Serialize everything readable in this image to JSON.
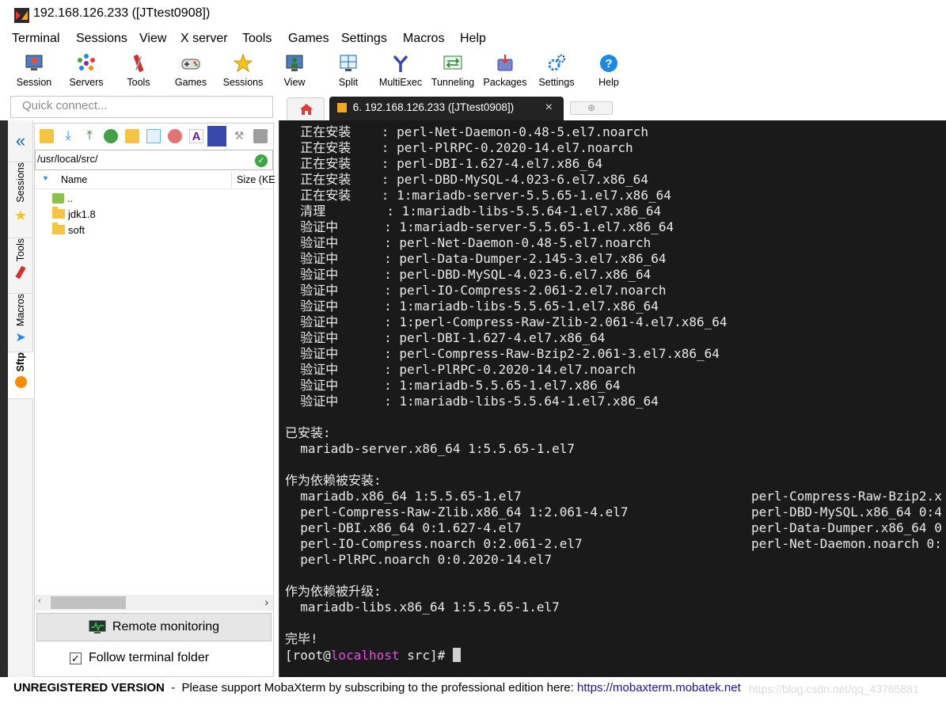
{
  "window": {
    "title": "192.168.126.233 ([JTtest0908])"
  },
  "menu": [
    "Terminal",
    "Sessions",
    "View",
    "X server",
    "Tools",
    "Games",
    "Settings",
    "Macros",
    "Help"
  ],
  "toolbar": [
    {
      "label": "Session",
      "icon": "session-icon"
    },
    {
      "label": "Servers",
      "icon": "servers-icon"
    },
    {
      "label": "Tools",
      "icon": "tools-icon"
    },
    {
      "label": "Games",
      "icon": "games-icon"
    },
    {
      "label": "Sessions",
      "icon": "sessions-star-icon"
    },
    {
      "label": "View",
      "icon": "view-icon"
    },
    {
      "label": "Split",
      "icon": "split-icon"
    },
    {
      "label": "MultiExec",
      "icon": "multiexec-icon"
    },
    {
      "label": "Tunneling",
      "icon": "tunneling-icon"
    },
    {
      "label": "Packages",
      "icon": "packages-icon"
    },
    {
      "label": "Settings",
      "icon": "settings-icon"
    },
    {
      "label": "Help",
      "icon": "help-icon"
    }
  ],
  "quick_connect": {
    "placeholder": "Quick connect..."
  },
  "side_tabs": [
    "Sessions",
    "Tools",
    "Macros",
    "Sftp"
  ],
  "sftp": {
    "path": "/usr/local/src/",
    "columns": {
      "name": "Name",
      "size": "Size (KE"
    },
    "items": [
      {
        "name": ".."
      },
      {
        "name": "jdk1.8"
      },
      {
        "name": "soft"
      }
    ],
    "remote_monitoring": "Remote monitoring",
    "follow_folder": "Follow terminal folder",
    "follow_checked": true
  },
  "tabs": {
    "active": "6. 192.168.126.233 ([JTtest0908])",
    "close": "×"
  },
  "terminal": {
    "lines": [
      "  正在安装    : perl-Net-Daemon-0.48-5.el7.noarch",
      "  正在安装    : perl-PlRPC-0.2020-14.el7.noarch",
      "  正在安装    : perl-DBI-1.627-4.el7.x86_64",
      "  正在安装    : perl-DBD-MySQL-4.023-6.el7.x86_64",
      "  正在安装    : 1:mariadb-server-5.5.65-1.el7.x86_64",
      "  清理        : 1:mariadb-libs-5.5.64-1.el7.x86_64",
      "  验证中      : 1:mariadb-server-5.5.65-1.el7.x86_64",
      "  验证中      : perl-Net-Daemon-0.48-5.el7.noarch",
      "  验证中      : perl-Data-Dumper-2.145-3.el7.x86_64",
      "  验证中      : perl-DBD-MySQL-4.023-6.el7.x86_64",
      "  验证中      : perl-IO-Compress-2.061-2.el7.noarch",
      "  验证中      : 1:mariadb-libs-5.5.65-1.el7.x86_64",
      "  验证中      : 1:perl-Compress-Raw-Zlib-2.061-4.el7.x86_64",
      "  验证中      : perl-DBI-1.627-4.el7.x86_64",
      "  验证中      : perl-Compress-Raw-Bzip2-2.061-3.el7.x86_64",
      "  验证中      : perl-PlRPC-0.2020-14.el7.noarch",
      "  验证中      : 1:mariadb-5.5.65-1.el7.x86_64",
      "  验证中      : 1:mariadb-libs-5.5.64-1.el7.x86_64",
      "",
      "已安装:",
      "  mariadb-server.x86_64 1:5.5.65-1.el7",
      "",
      "作为依赖被安装:",
      "  mariadb.x86_64 1:5.5.65-1.el7",
      "  perl-Compress-Raw-Zlib.x86_64 1:2.061-4.el7",
      "  perl-DBI.x86_64 0:1.627-4.el7",
      "  perl-IO-Compress.noarch 0:2.061-2.el7",
      "  perl-PlRPC.noarch 0:0.2020-14.el7",
      "",
      "作为依赖被升级:",
      "  mariadb-libs.x86_64 1:5.5.65-1.el7",
      "",
      "完毕!"
    ],
    "right_col": [
      "perl-Compress-Raw-Bzip2.x",
      "perl-DBD-MySQL.x86_64 0:4",
      "perl-Data-Dumper.x86_64 0",
      "perl-Net-Daemon.noarch 0:"
    ],
    "prompt": {
      "open": "[root@",
      "host": "localhost",
      "rest": " src]# "
    },
    "colors": {
      "background": "#1a1a1a",
      "text": "#e9e9e9",
      "host": "#e34ee0"
    }
  },
  "status": {
    "unregistered": "UNREGISTERED VERSION",
    "message": "  -  Please support MobaXterm by subscribing to the professional edition here: ",
    "link": "https://mobaxterm.mobatek.net",
    "watermark": "https://blog.csdn.net/qq_43765881"
  }
}
